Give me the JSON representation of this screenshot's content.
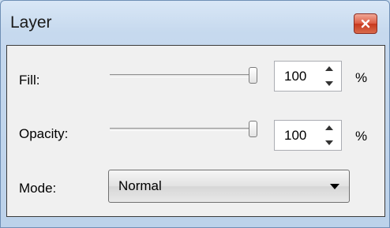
{
  "window": {
    "title": "Layer"
  },
  "fill": {
    "label": "Fill:",
    "value": "100",
    "unit": "%",
    "slider_level": 1.0
  },
  "opacity": {
    "label": "Opacity:",
    "value": "100",
    "unit": "%",
    "slider_level": 1.0
  },
  "mode": {
    "label": "Mode:",
    "selected": "Normal"
  },
  "icons": {
    "close": "close-icon",
    "spin_up": "up-arrow-icon",
    "spin_down": "down-arrow-icon",
    "dropdown": "dropdown-arrow-icon"
  },
  "colors": {
    "close_button": "#d04a30",
    "panel_bg": "#f0f0f0",
    "frame_bg": "#c6d9ee"
  }
}
